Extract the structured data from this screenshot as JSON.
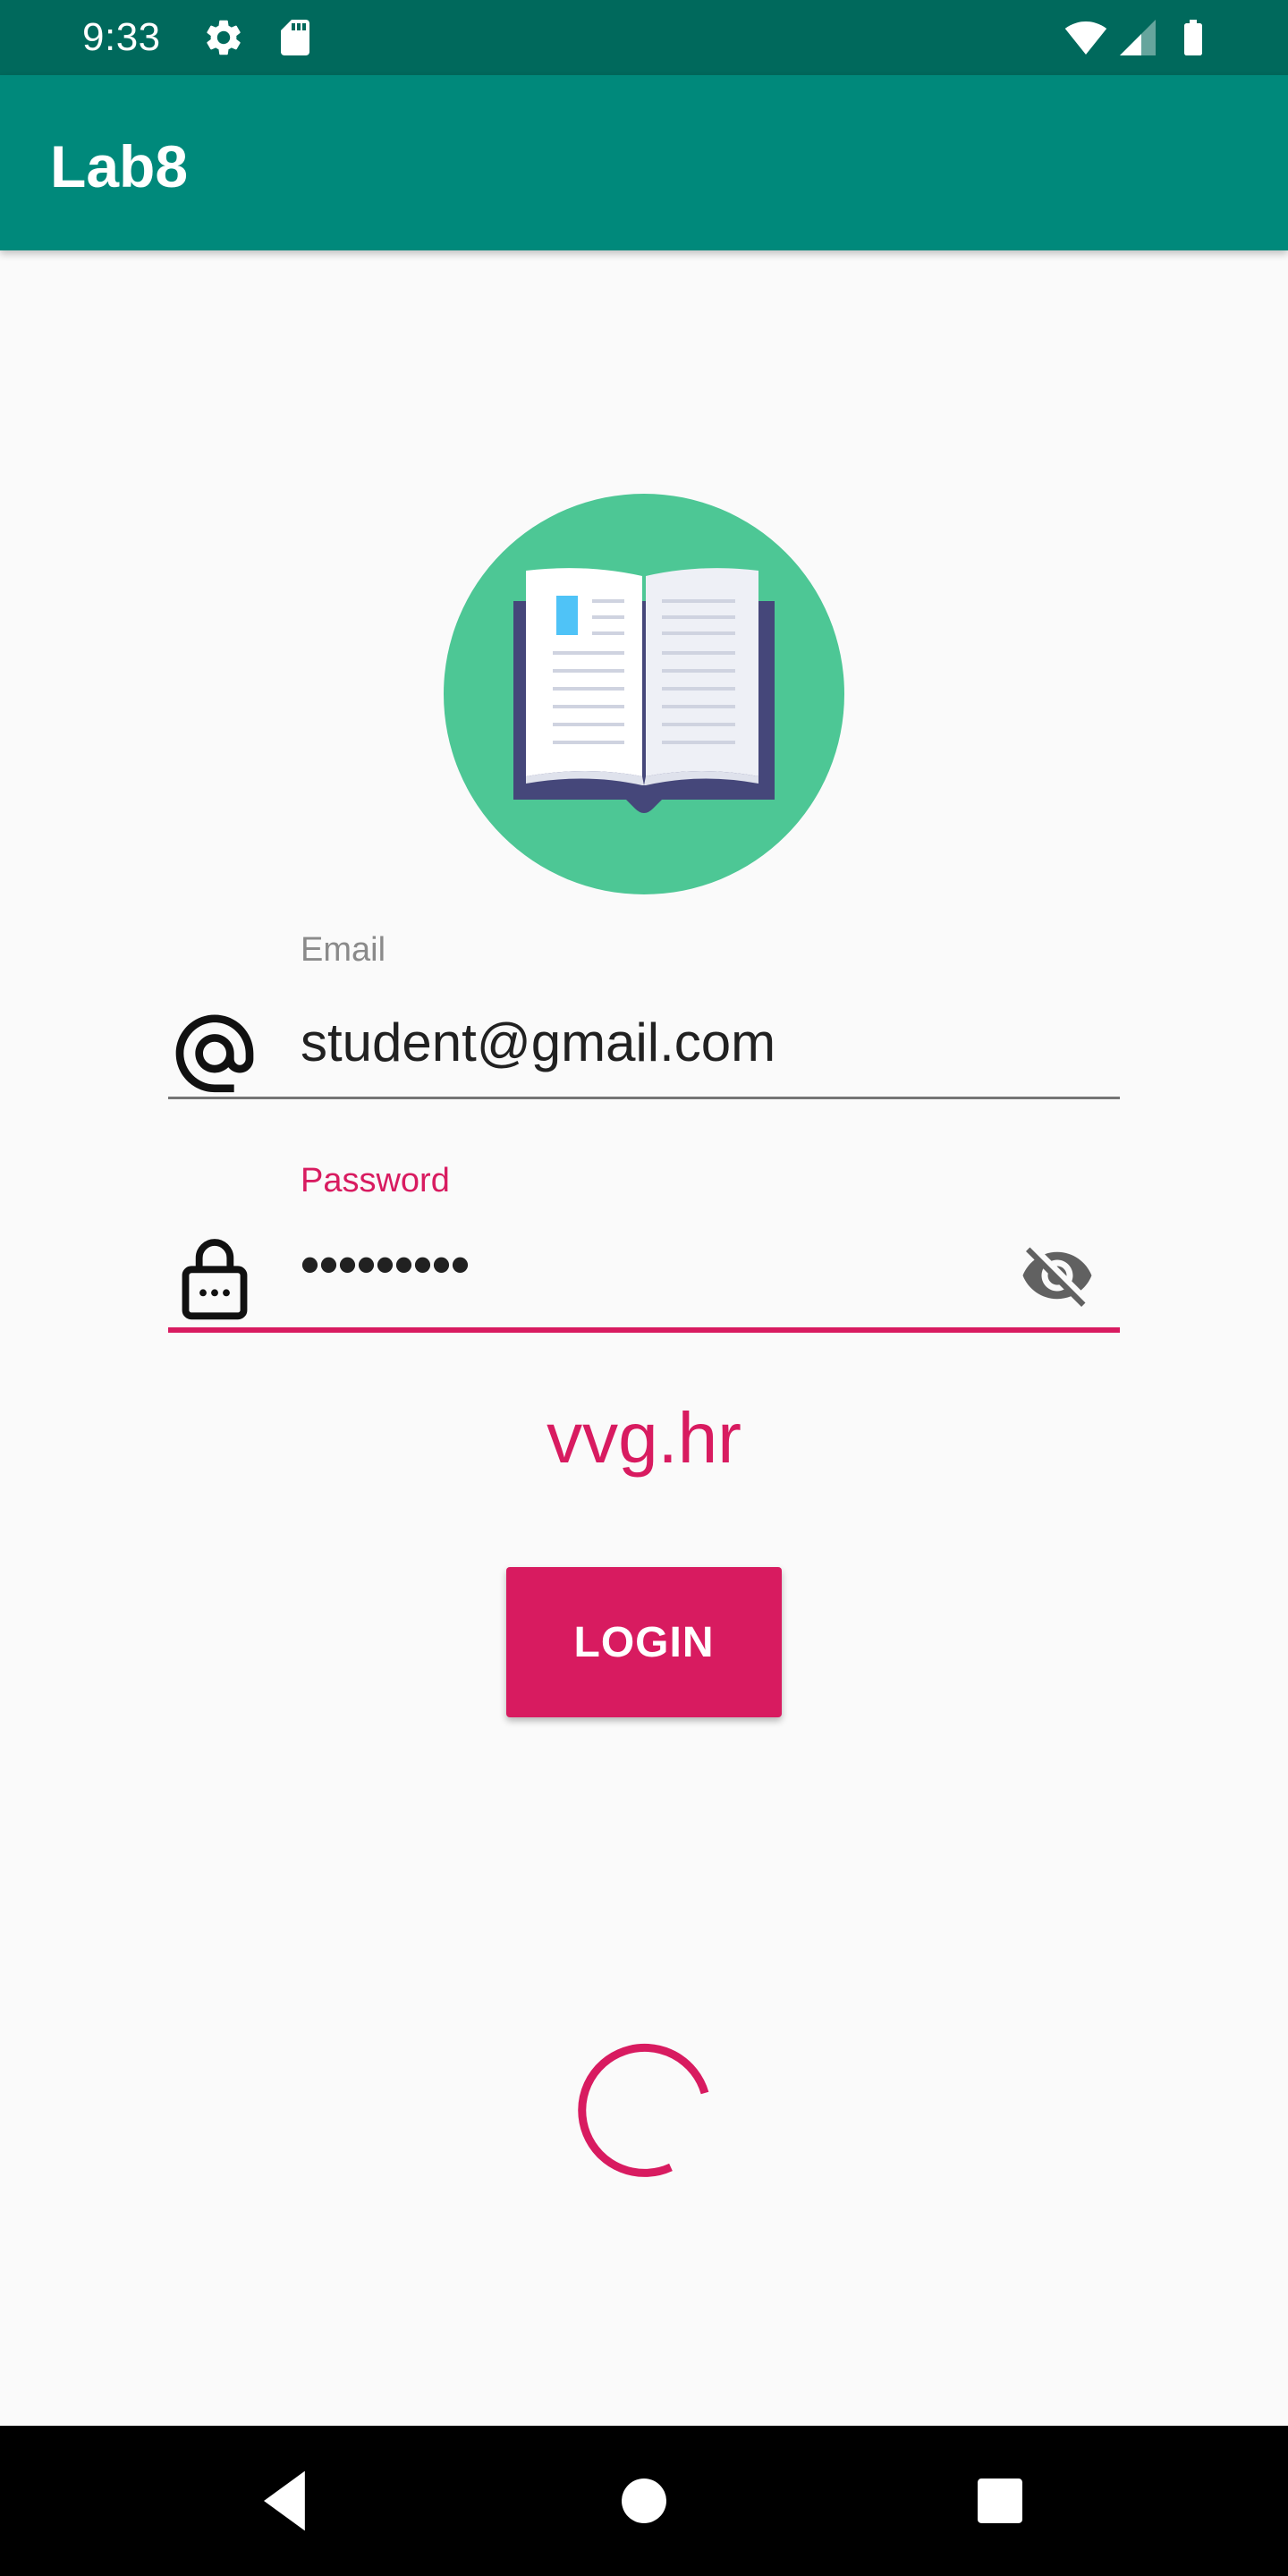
{
  "status_bar": {
    "time": "9:33",
    "icons": [
      "settings-icon",
      "sd-card-icon",
      "wifi-icon",
      "signal-icon",
      "battery-icon"
    ]
  },
  "app_bar": {
    "title": "Lab8"
  },
  "logo": {
    "icon": "open-book-icon"
  },
  "email_field": {
    "label": "Email",
    "value": "student@gmail.com",
    "icon": "at-sign-icon"
  },
  "password_field": {
    "label": "Password",
    "value": "•••••••••",
    "icon": "lock-icon",
    "toggle_icon": "visibility-off-icon"
  },
  "link": {
    "text": "vvg.hr"
  },
  "login_button": {
    "label": "LOGIN"
  },
  "nav_bar": {
    "icons": [
      "back-icon",
      "home-icon",
      "recents-icon"
    ]
  },
  "colors": {
    "status_bar": "#00695c",
    "app_bar": "#00897b",
    "accent": "#d81b60",
    "logo_circle": "#4dc795",
    "book_cover": "#45477a",
    "background": "#fafafa"
  }
}
